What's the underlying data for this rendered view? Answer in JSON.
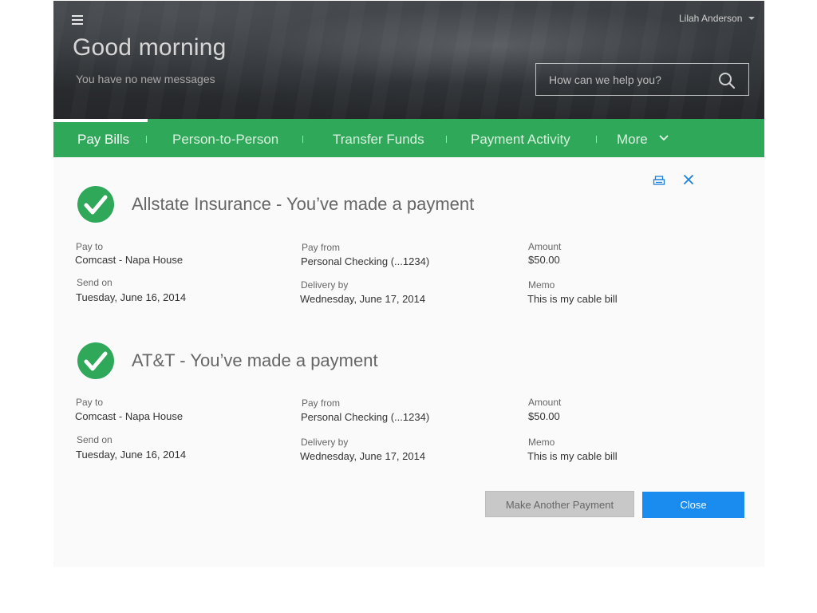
{
  "header": {
    "greeting": "Good morning",
    "messages": "You have no new messages",
    "user_name": "Lilah Anderson",
    "search_placeholder": "How can we help you?"
  },
  "nav": {
    "tabs": [
      {
        "label": "Pay Bills",
        "active": true
      },
      {
        "label": "Person-to-Person",
        "active": false
      },
      {
        "label": "Transfer Funds",
        "active": false
      },
      {
        "label": "Payment Activity",
        "active": false
      },
      {
        "label": "More",
        "active": false
      }
    ]
  },
  "payments": [
    {
      "title": "Allstate Insurance - You’ve made a payment",
      "pay_to_label": "Pay to",
      "pay_to": "Comcast - Napa House",
      "pay_from_label": "Pay from",
      "pay_from": "Personal Checking (...1234)",
      "amount_label": "Amount",
      "amount": "$50.00",
      "send_on_label": "Send on",
      "send_on": "Tuesday,  June 16, 2014",
      "delivery_label": "Delivery by",
      "delivery": "Wednesday,  June 17, 2014",
      "memo_label": "Memo",
      "memo": "This is my cable bill"
    },
    {
      "title": "AT&T - You’ve made a payment",
      "pay_to_label": "Pay to",
      "pay_to": "Comcast - Napa House",
      "pay_from_label": "Pay from",
      "pay_from": "Personal Checking (...1234)",
      "amount_label": "Amount",
      "amount": "$50.00",
      "send_on_label": "Send on",
      "send_on": "Tuesday,  June 16, 2014",
      "delivery_label": "Delivery by",
      "delivery": "Wednesday,  June 17, 2014",
      "memo_label": "Memo",
      "memo": "This is my cable bill"
    }
  ],
  "actions": {
    "make_another_label": "Make Another Payment",
    "close_label": "Close"
  },
  "icons": {
    "menu": "hamburger-icon",
    "search": "search-icon",
    "print": "print-icon",
    "close": "close-icon",
    "success": "checkmark-icon"
  },
  "colors": {
    "nav_green": "#30a85a",
    "primary_blue": "#1a8cf0",
    "secondary_gray": "#c8c8c8"
  }
}
